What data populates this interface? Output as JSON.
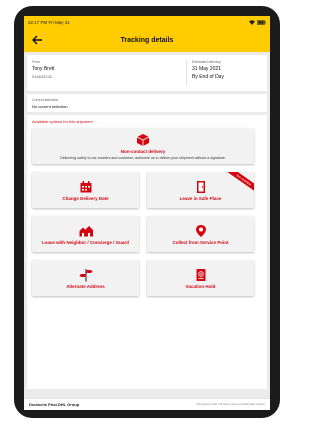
{
  "status": {
    "time": "02:17 PM",
    "date": "Fri May 31"
  },
  "header": {
    "title": "Tracking details"
  },
  "recipient": {
    "from_label": "From",
    "name": "Tony Brett",
    "number": "534634242",
    "estimated_label": "Estimated delivery",
    "date": "31 May 2021",
    "time": "By End of Day"
  },
  "selection": {
    "label": "Current selection",
    "value": "No current selection"
  },
  "options": {
    "header": "Available options for this shipment",
    "non_contact": {
      "label": "Non-contact delivery",
      "desc": "Delivering safely to our couriers and customer, authorize us to deliver your shipment without a signature."
    },
    "tiles": [
      {
        "label": "Change Delivery Date",
        "icon": "calendar-icon"
      },
      {
        "label": "Leave in Safe Place",
        "icon": "door-icon",
        "ribbon": "Not available"
      },
      {
        "label": "Leave with Neighbor / Concierge / Guard",
        "icon": "houses-icon"
      },
      {
        "label": "Collect from Service Point",
        "icon": "location-pin-icon"
      },
      {
        "label": "Alternate Address",
        "icon": "signpost-icon"
      },
      {
        "label": "Vacation Hold",
        "icon": "passport-icon"
      }
    ]
  },
  "footer": {
    "brand": "Deutsche Post DHL Group",
    "copyright": "DHL Express 2021 | All rights reserved | Global Sales Support"
  },
  "colors": {
    "accent": "#ffcc00",
    "brand_red": "#d40511"
  }
}
